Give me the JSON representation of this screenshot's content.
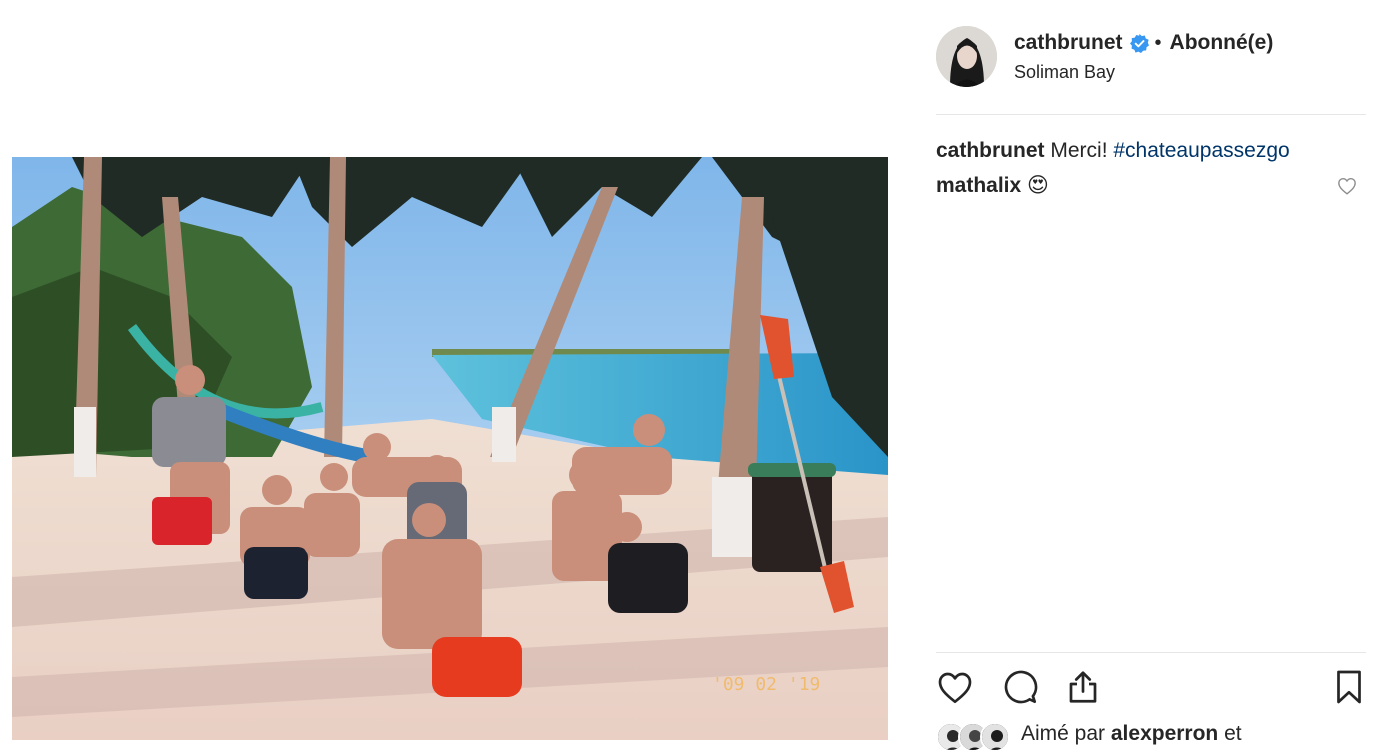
{
  "post": {
    "author": "cathbrunet",
    "separator": "•",
    "follow_label": "Abonné(e)",
    "location": "Soliman Bay"
  },
  "comments": [
    {
      "user": "cathbrunet",
      "text": "Merci!",
      "hashtag": "#chateaupassezgo"
    },
    {
      "user": "mathalix",
      "emoji": "😍"
    }
  ],
  "likes": {
    "prefix": "Aimé par",
    "liked_by": "alexperron",
    "suffix": "et"
  },
  "icons": {
    "like": "heart-icon",
    "comment": "speech-bubble-icon",
    "share": "share-icon",
    "save": "bookmark-icon",
    "verified": "verified-badge-icon",
    "comment_like": "heart-icon"
  },
  "colors": {
    "text": "#262626",
    "hashtag": "#003569",
    "verified": "#3897f0",
    "divider": "#e6e6e6"
  }
}
